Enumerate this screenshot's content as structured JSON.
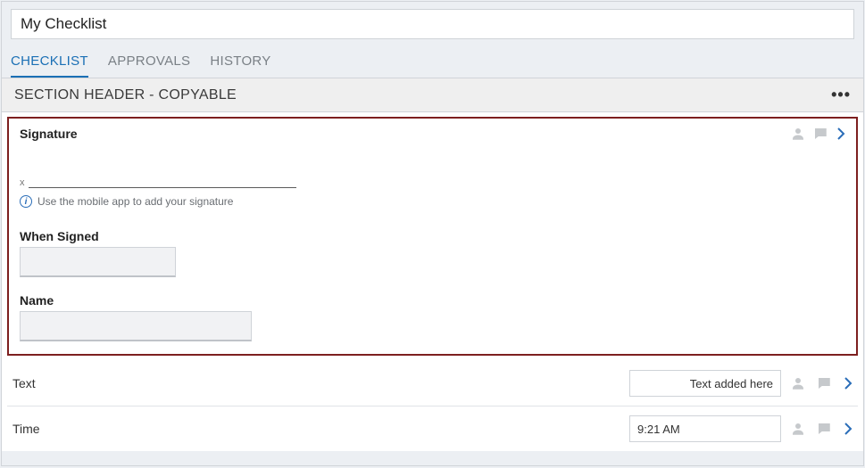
{
  "title": "My Checklist",
  "tabs": [
    {
      "label": "CHECKLIST",
      "active": true
    },
    {
      "label": "APPROVALS",
      "active": false
    },
    {
      "label": "HISTORY",
      "active": false
    }
  ],
  "section_header": "SECTION HEADER - COPYABLE",
  "signature": {
    "title": "Signature",
    "x_mark": "x",
    "info": "Use the mobile app to add your signature",
    "when_signed_label": "When Signed",
    "when_signed_value": "",
    "name_label": "Name",
    "name_value": ""
  },
  "rows": [
    {
      "label": "Text",
      "value": "Text added here",
      "align": "right"
    },
    {
      "label": "Time",
      "value": "9:21 AM",
      "align": "left"
    }
  ]
}
